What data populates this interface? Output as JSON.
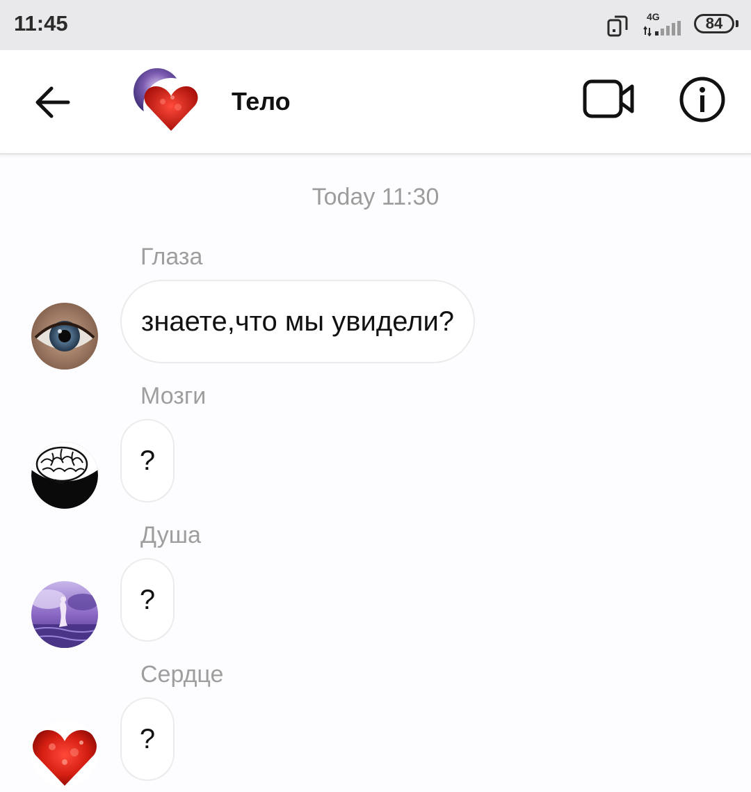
{
  "status_bar": {
    "time": "11:45",
    "network": "4G",
    "battery": "84",
    "icons": [
      "screen-rotate-icon",
      "signal-4g-icon",
      "battery-icon"
    ]
  },
  "header": {
    "title": "Тело",
    "icons": [
      "back-arrow-icon",
      "group-avatar",
      "video-call-icon",
      "info-icon"
    ]
  },
  "conversation": {
    "timestamp": "Today 11:30",
    "messages": [
      {
        "sender": "Глаза",
        "text": "знаете,что мы увидели?",
        "avatar": "eye-avatar"
      },
      {
        "sender": "Мозги",
        "text": "?",
        "avatar": "brain-avatar"
      },
      {
        "sender": "Душа",
        "text": "?",
        "avatar": "soul-avatar"
      },
      {
        "sender": "Сердце",
        "text": "?",
        "avatar": "heart-avatar"
      }
    ]
  },
  "colors": {
    "background": "#fdfcfe",
    "status_bar": "#e9e8ea",
    "secondary_text": "#9e9e9e",
    "bubble_border": "#ebebeb",
    "heart_red": "#d41e12"
  }
}
